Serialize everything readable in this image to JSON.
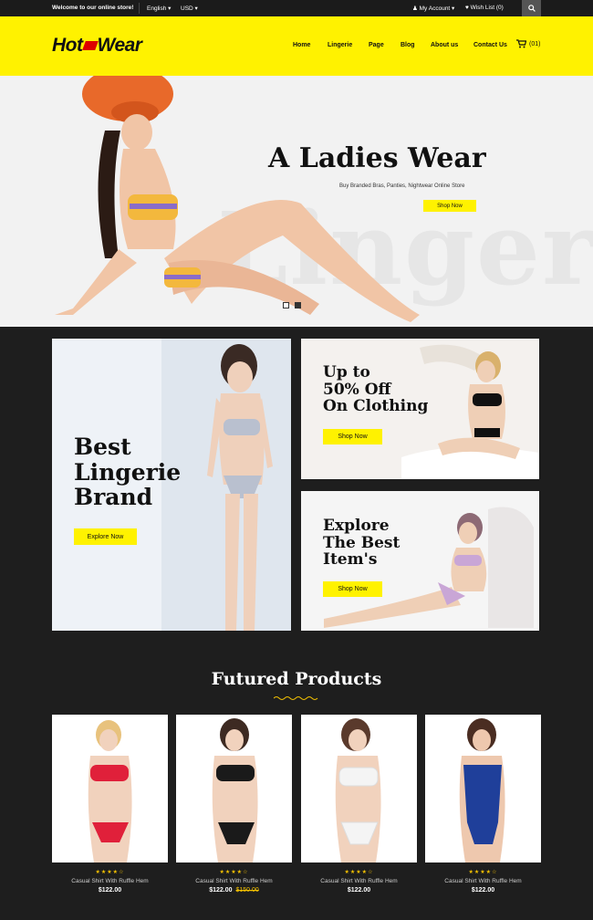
{
  "topbar": {
    "welcome": "Welcome to our online store!",
    "language": "English ▾",
    "currency": "USD ▾",
    "account": "My Account ▾",
    "wishlist": "Wish List (0)"
  },
  "header": {
    "logo_left": "Hot",
    "logo_right": "Wear",
    "nav": [
      "Home",
      "Lingerie",
      "Page",
      "Blog",
      "About us",
      "Contact Us"
    ],
    "cart_count": "(01)"
  },
  "hero": {
    "bg_word": "Lingerie",
    "title": "A Ladies Wear",
    "subtitle": "Buy Branded Bras, Panties, Nightwear Online Store",
    "button": "Shop Now"
  },
  "promos": {
    "left_line1": "Best",
    "left_line2": "Lingerie",
    "left_line3": "Brand",
    "left_button": "Explore Now",
    "top_line1": "Up to",
    "top_line2": "50% Off",
    "top_line3": "On Clothing",
    "top_button": "Shop Now",
    "bottom_line1": "Explore",
    "bottom_line2": "The Best",
    "bottom_line3": "Item's",
    "bottom_button": "Shop Now"
  },
  "featured": {
    "title": "Futured Products",
    "products": [
      {
        "stars": "★★★★☆",
        "name": "Casual Shirt With Ruffle Hem",
        "price": "$122.00",
        "old_price": ""
      },
      {
        "stars": "★★★★☆",
        "name": "Casual Shirt With Ruffle Hem",
        "price": "$122.00",
        "old_price": "$150.00"
      },
      {
        "stars": "★★★★☆",
        "name": "Casual Shirt With Ruffle Hem",
        "price": "$122.00",
        "old_price": ""
      },
      {
        "stars": "★★★★☆",
        "name": "Casual Shirt With Ruffle Hem",
        "price": "$122.00",
        "old_price": ""
      }
    ]
  },
  "colors": {
    "accent": "#fff200",
    "dark": "#1e1e1e",
    "topbar": "#1b1b1b"
  }
}
